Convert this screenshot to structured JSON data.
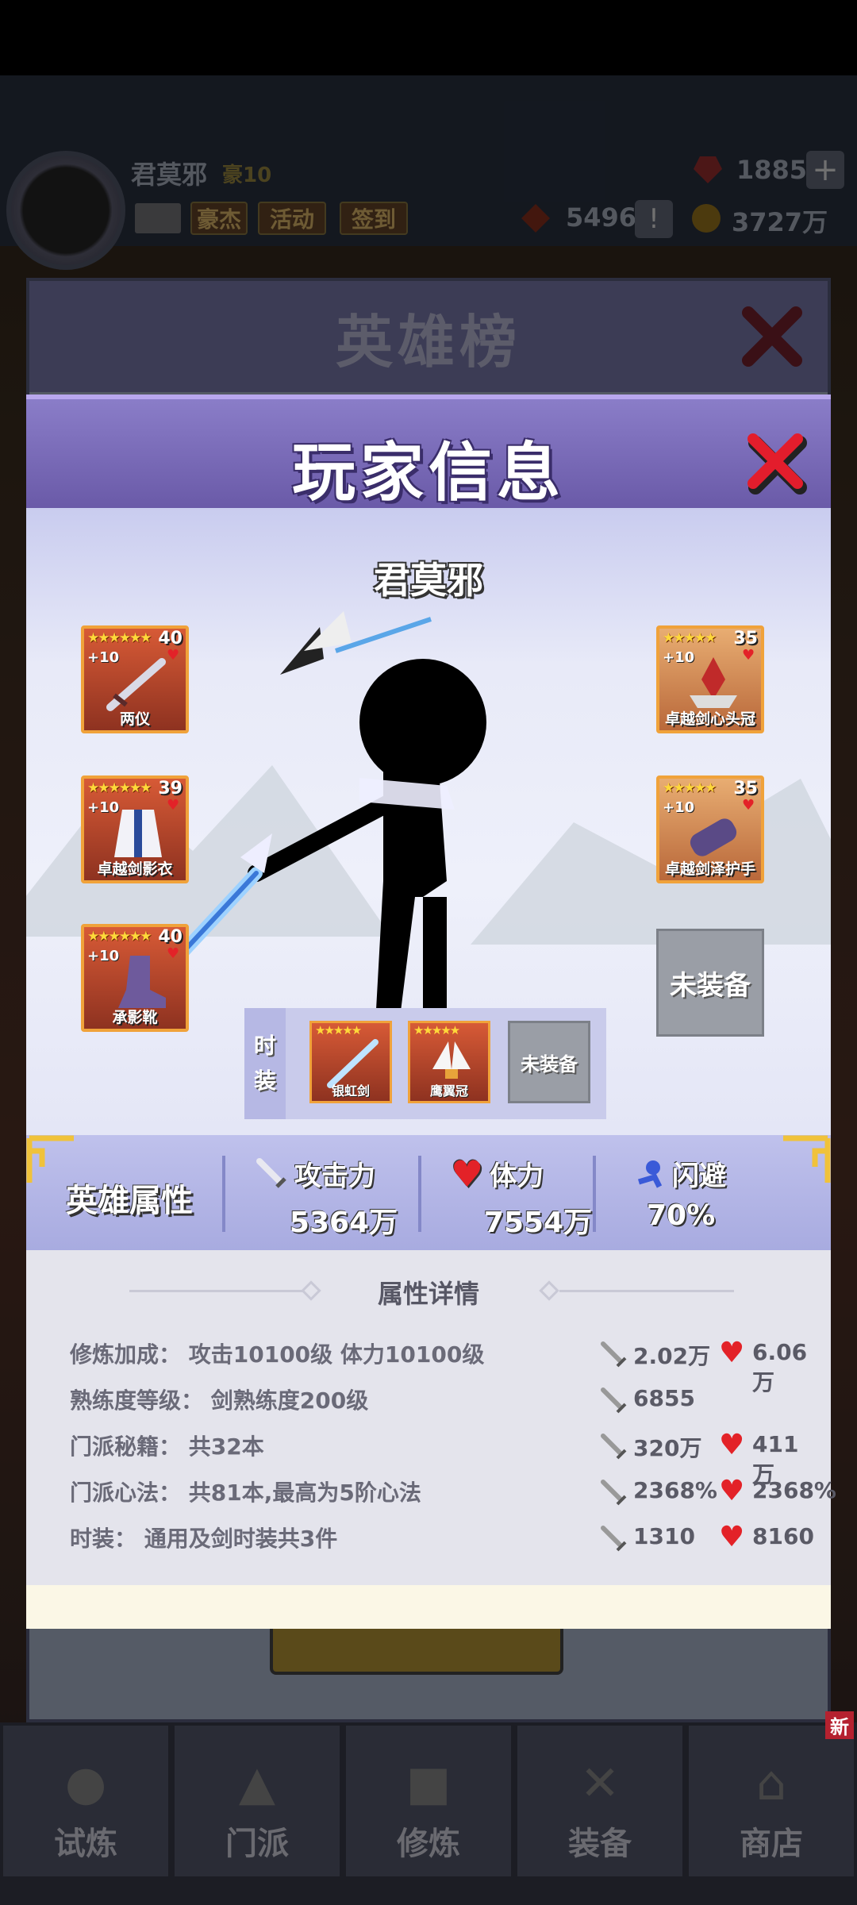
{
  "top_bar": {
    "player_name": "君莫邪",
    "vip_label": "豪10",
    "buttons": [
      "豪杰",
      "活动",
      "签到"
    ],
    "gems": "1885",
    "tokens": "5496",
    "coins": "3727万"
  },
  "hero_board": {
    "title": "英雄榜"
  },
  "modal": {
    "title": "玩家信息",
    "player_name": "君莫邪",
    "equipment_left": [
      {
        "name": "两仪",
        "level": "40",
        "plus": "+10",
        "stars": "★★★★★★"
      },
      {
        "name": "卓越剑影衣",
        "level": "39",
        "plus": "+10",
        "stars": "★★★★★★"
      },
      {
        "name": "承影靴",
        "level": "40",
        "plus": "+10",
        "stars": "★★★★★★"
      }
    ],
    "equipment_right": [
      {
        "name": "卓越剑心头冠",
        "level": "35",
        "plus": "+10",
        "stars": "★★★★★"
      },
      {
        "name": "卓越剑泽护手",
        "level": "35",
        "plus": "+10",
        "stars": "★★★★★"
      }
    ],
    "empty_slot_label": "未装备",
    "fashion": {
      "label_1": "时",
      "label_2": "装",
      "items": [
        {
          "name": "银虹剑",
          "stars": "★★★★★"
        },
        {
          "name": "鹰翼冠",
          "stars": "★★★★★"
        }
      ],
      "empty_label": "未装备"
    },
    "attributes": {
      "title": "英雄属性",
      "attack_label": "攻击力",
      "attack_value": "5364万",
      "hp_label": "体力",
      "hp_value": "7554万",
      "dodge_label": "闪避",
      "dodge_value": "70%"
    },
    "details": {
      "title": "属性详情",
      "rows": [
        {
          "label": "修炼加成：  攻击10100级 体力10100级",
          "atk": "2.02万",
          "hp": "6.06万"
        },
        {
          "label": "熟练度等级：  剑熟练度200级",
          "atk": "6855",
          "hp": ""
        },
        {
          "label": "门派秘籍：  共32本",
          "atk": "320万",
          "hp": "411万"
        },
        {
          "label": "门派心法：  共81本,最高为5阶心法",
          "atk": "2368%",
          "hp": "2368%"
        },
        {
          "label": "时装：  通用及剑时装共3件",
          "atk": "1310",
          "hp": "8160"
        }
      ]
    }
  },
  "bottom_nav": {
    "items": [
      "试炼",
      "门派",
      "修炼",
      "装备",
      "商店"
    ],
    "new_badge": "新"
  },
  "colors": {
    "modal_header": "#6a5aa8",
    "attr_strip": "#a8abe0",
    "heart": "#e32228",
    "equip_border": "#f0a23a"
  }
}
